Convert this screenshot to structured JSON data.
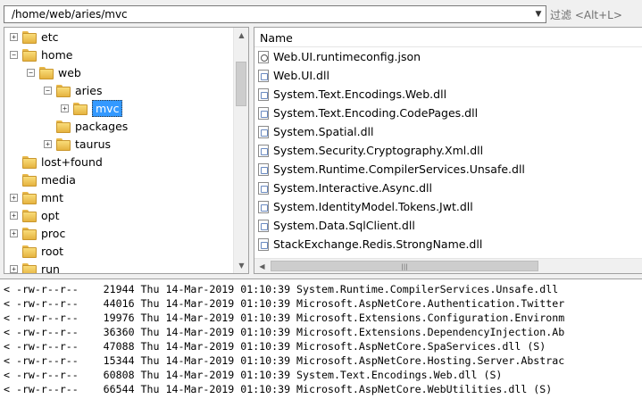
{
  "path_bar": {
    "path": "/home/web/aries/mvc",
    "filter_placeholder": "过滤 <Alt+L>"
  },
  "tree": {
    "items": [
      {
        "label": "etc",
        "expander": "+",
        "level": 0,
        "selected": false
      },
      {
        "label": "home",
        "expander": "-",
        "level": 0,
        "selected": false
      },
      {
        "label": "web",
        "expander": "-",
        "level": 1,
        "selected": false
      },
      {
        "label": "aries",
        "expander": "-",
        "level": 2,
        "selected": false
      },
      {
        "label": "mvc",
        "expander": "+",
        "level": 3,
        "selected": true
      },
      {
        "label": "packages",
        "expander": "",
        "level": 2,
        "selected": false
      },
      {
        "label": "taurus",
        "expander": "+",
        "level": 2,
        "selected": false
      },
      {
        "label": "lost+found",
        "expander": "",
        "level": 0,
        "selected": false
      },
      {
        "label": "media",
        "expander": "",
        "level": 0,
        "selected": false
      },
      {
        "label": "mnt",
        "expander": "+",
        "level": 0,
        "selected": false
      },
      {
        "label": "opt",
        "expander": "+",
        "level": 0,
        "selected": false
      },
      {
        "label": "proc",
        "expander": "+",
        "level": 0,
        "selected": false
      },
      {
        "label": "root",
        "expander": "",
        "level": 0,
        "selected": false
      },
      {
        "label": "run",
        "expander": "+",
        "level": 0,
        "selected": false
      }
    ]
  },
  "file_list": {
    "header": "Name",
    "files": [
      {
        "name": "Web.UI.runtimeconfig.json",
        "icon": "json-file-icon"
      },
      {
        "name": "Web.UI.dll",
        "icon": "dll-file-icon"
      },
      {
        "name": "System.Text.Encodings.Web.dll",
        "icon": "dll-file-icon"
      },
      {
        "name": "System.Text.Encoding.CodePages.dll",
        "icon": "dll-file-icon"
      },
      {
        "name": "System.Spatial.dll",
        "icon": "dll-file-icon"
      },
      {
        "name": "System.Security.Cryptography.Xml.dll",
        "icon": "dll-file-icon"
      },
      {
        "name": "System.Runtime.CompilerServices.Unsafe.dll",
        "icon": "dll-file-icon"
      },
      {
        "name": "System.Interactive.Async.dll",
        "icon": "dll-file-icon"
      },
      {
        "name": "System.IdentityModel.Tokens.Jwt.dll",
        "icon": "dll-file-icon"
      },
      {
        "name": "System.Data.SqlClient.dll",
        "icon": "dll-file-icon"
      },
      {
        "name": "StackExchange.Redis.StrongName.dll",
        "icon": "dll-file-icon"
      }
    ]
  },
  "log": {
    "lines": [
      "< -rw-r--r--    21944 Thu 14-Mar-2019 01:10:39 System.Runtime.CompilerServices.Unsafe.dll",
      "< -rw-r--r--    44016 Thu 14-Mar-2019 01:10:39 Microsoft.AspNetCore.Authentication.Twitter",
      "< -rw-r--r--    19976 Thu 14-Mar-2019 01:10:39 Microsoft.Extensions.Configuration.Environm",
      "< -rw-r--r--    36360 Thu 14-Mar-2019 01:10:39 Microsoft.Extensions.DependencyInjection.Ab",
      "< -rw-r--r--    47088 Thu 14-Mar-2019 01:10:39 Microsoft.AspNetCore.SpaServices.dll (S)",
      "< -rw-r--r--    15344 Thu 14-Mar-2019 01:10:39 Microsoft.AspNetCore.Hosting.Server.Abstrac",
      "< -rw-r--r--    60808 Thu 14-Mar-2019 01:10:39 System.Text.Encodings.Web.dll (S)",
      "< -rw-r--r--    66544 Thu 14-Mar-2019 01:10:39 Microsoft.AspNetCore.WebUtilities.dll (S)"
    ]
  },
  "colors": {
    "selection": "#3399ff",
    "folder": "#e5b33f"
  }
}
